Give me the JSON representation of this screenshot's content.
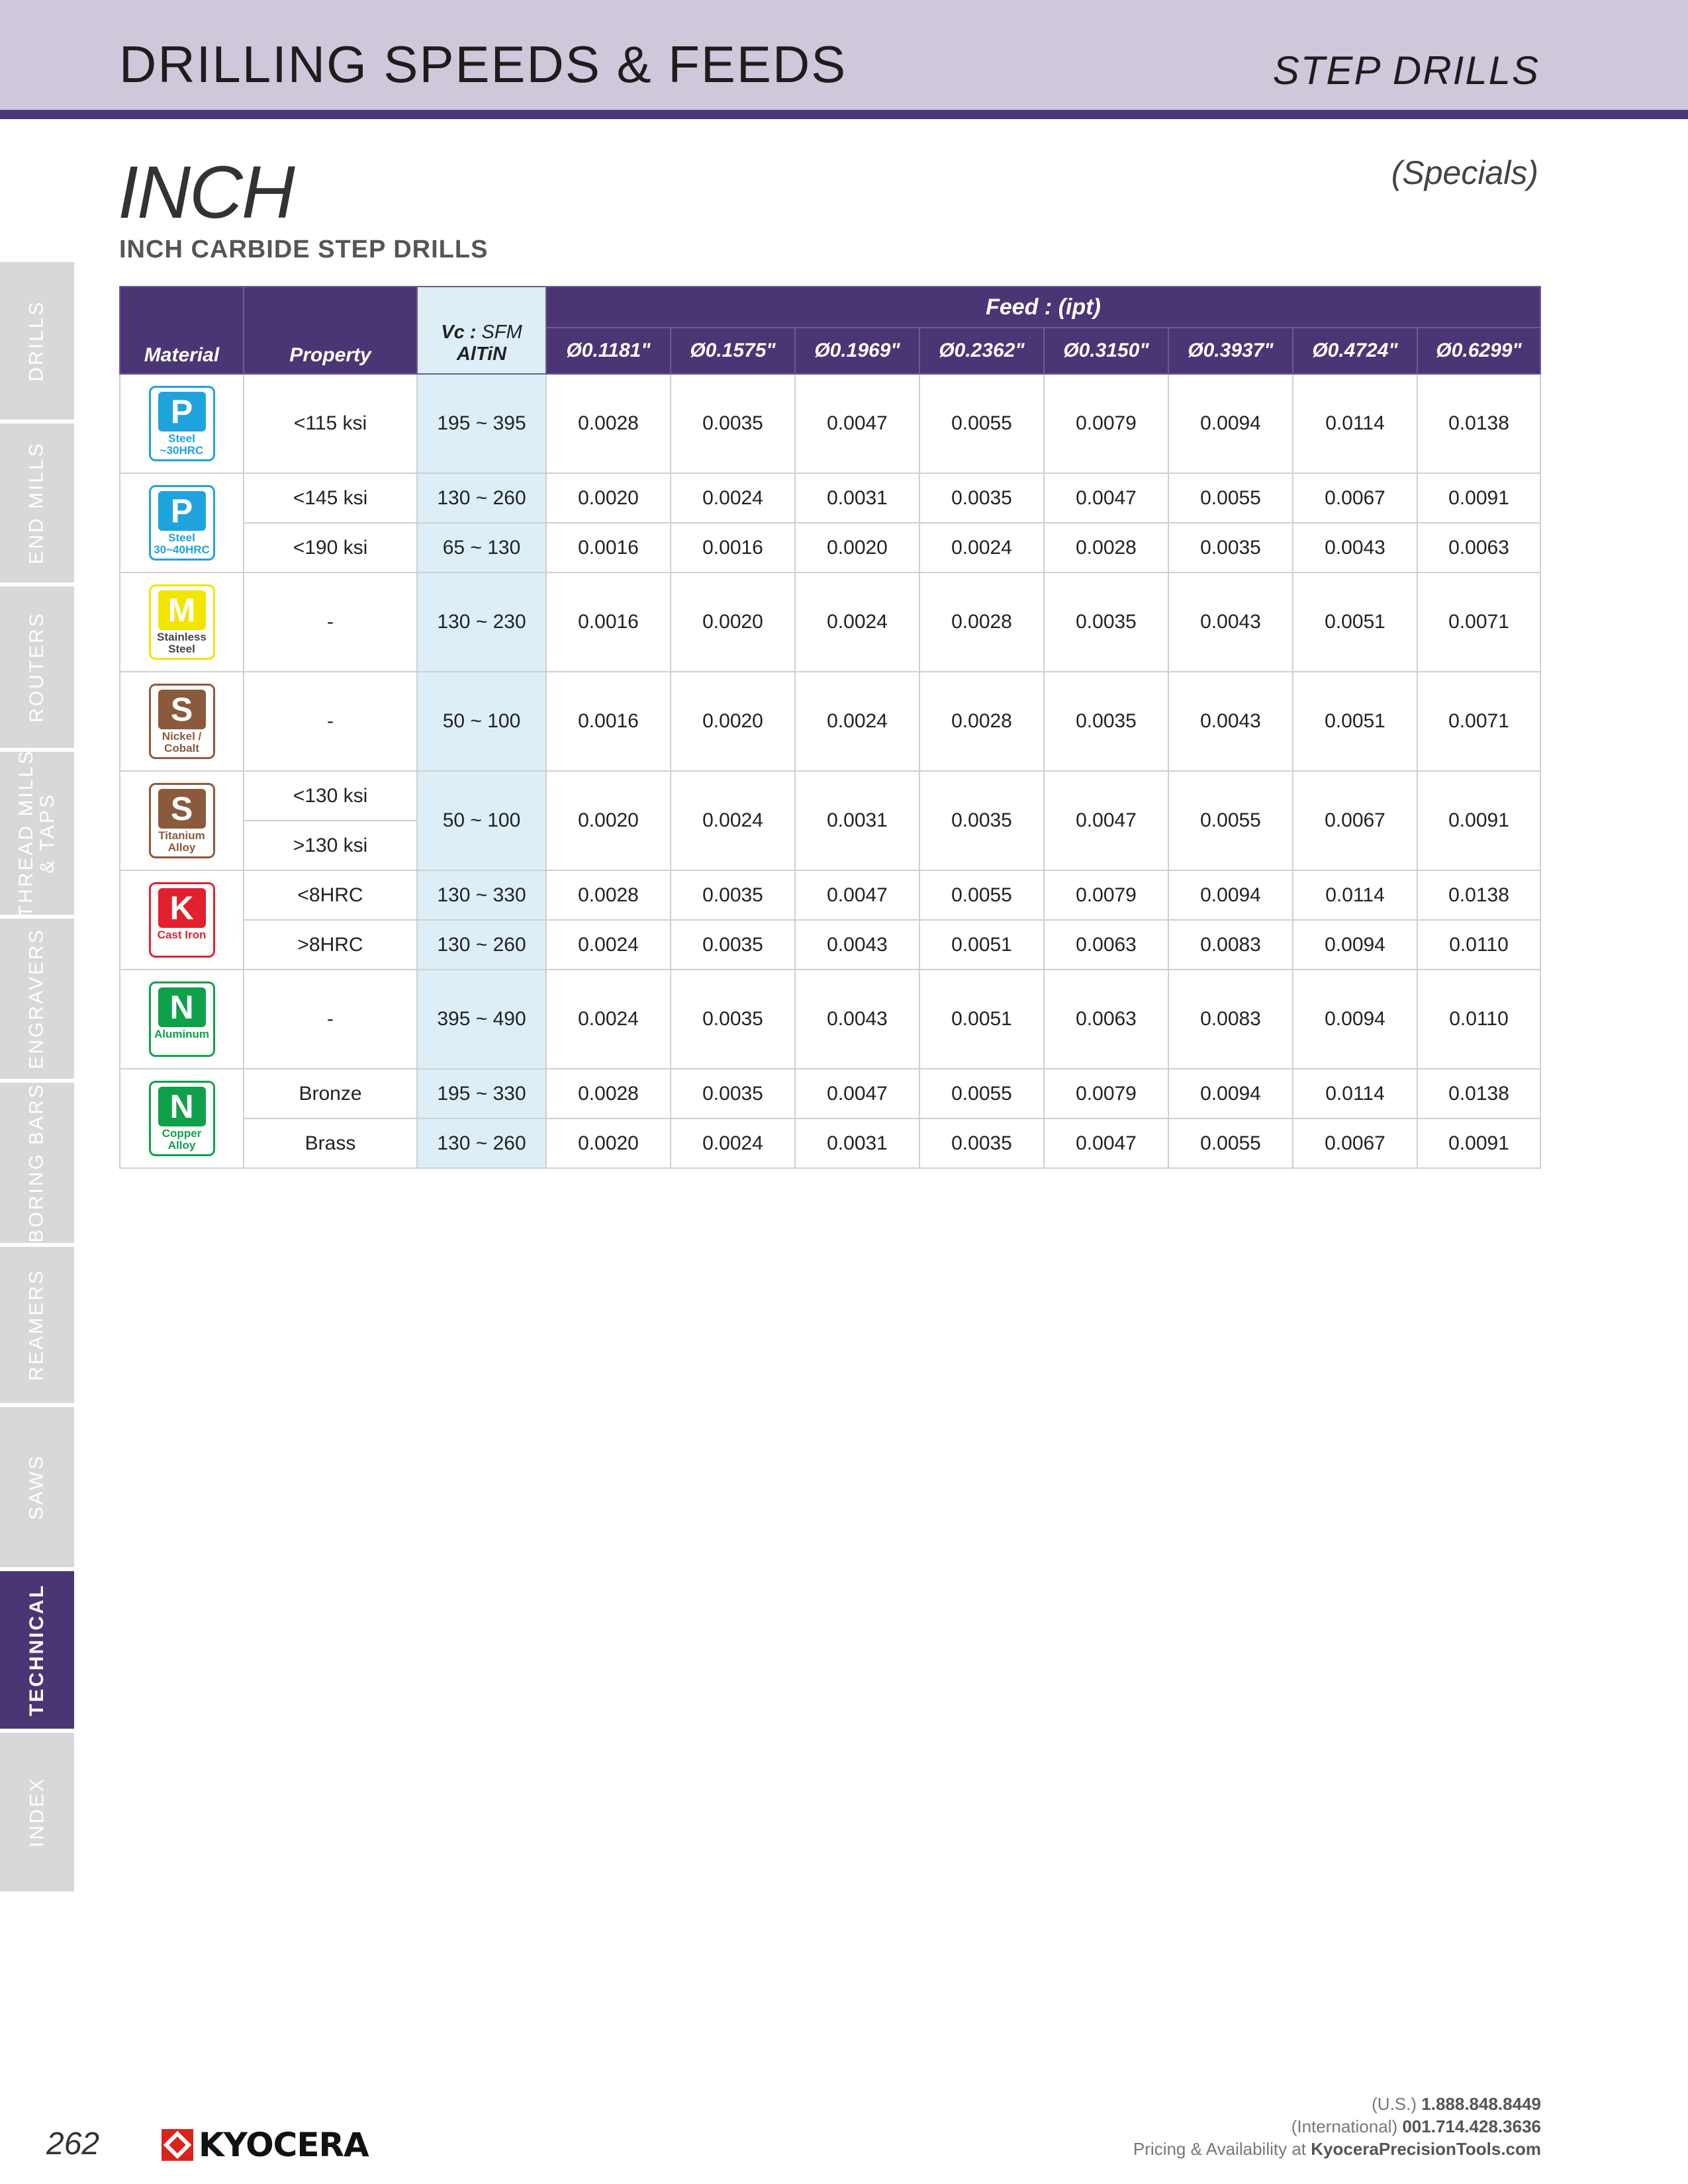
{
  "header": {
    "title": "DRILLING SPEEDS & FEEDS",
    "section": "STEP DRILLS"
  },
  "unit_title": "INCH",
  "specials": "(Specials)",
  "subtitle": "INCH CARBIDE STEP DRILLS",
  "side_tabs": [
    {
      "label": "DRILLS",
      "active": false
    },
    {
      "label": "END MILLS",
      "active": false
    },
    {
      "label": "ROUTERS",
      "active": false
    },
    {
      "label": "THREAD MILLS & TAPS",
      "line1": "THREAD MILLS",
      "line2": "& TAPS",
      "active": false
    },
    {
      "label": "ENGRAVERS",
      "active": false
    },
    {
      "label": "BORING BARS",
      "active": false
    },
    {
      "label": "REAMERS",
      "active": false
    },
    {
      "label": "SAWS",
      "active": false
    },
    {
      "label": "TECHNICAL",
      "active": true
    },
    {
      "label": "INDEX",
      "active": false
    }
  ],
  "table": {
    "material_header": "Material",
    "property_header": "Property",
    "vc_header_bold": "Vc :",
    "vc_header_unit": "SFM",
    "vc_header_coating": "AlTiN",
    "feed_header": "Feed : (ipt)",
    "diameters": [
      "Ø0.1181\"",
      "Ø0.1575\"",
      "Ø0.1969\"",
      "Ø0.2362\"",
      "Ø0.3150\"",
      "Ø0.3937\"",
      "Ø0.4724\"",
      "Ø0.6299\""
    ],
    "groups": [
      {
        "badge_letter": "P",
        "badge_name": "Steel ~30HRC",
        "badge_color": "#1fa3dc",
        "badge_text_color": "#1fa3dc",
        "rows": [
          {
            "property": "<115 ksi",
            "vc": "195 ~ 395",
            "feeds": [
              "0.0028",
              "0.0035",
              "0.0047",
              "0.0055",
              "0.0079",
              "0.0094",
              "0.0114",
              "0.0138"
            ]
          }
        ]
      },
      {
        "badge_letter": "P",
        "badge_name": "Steel 30~40HRC",
        "badge_color": "#1fa3dc",
        "badge_text_color": "#1fa3dc",
        "rows": [
          {
            "property": "<145 ksi",
            "vc": "130 ~ 260",
            "feeds": [
              "0.0020",
              "0.0024",
              "0.0031",
              "0.0035",
              "0.0047",
              "0.0055",
              "0.0067",
              "0.0091"
            ]
          },
          {
            "property": "<190 ksi",
            "vc": "65 ~ 130",
            "feeds": [
              "0.0016",
              "0.0016",
              "0.0020",
              "0.0024",
              "0.0028",
              "0.0035",
              "0.0043",
              "0.0063"
            ]
          }
        ]
      },
      {
        "badge_letter": "M",
        "badge_name": "Stainless Steel",
        "badge_color": "#f2e500",
        "badge_text_color": "#444444",
        "rows": [
          {
            "property": "-",
            "vc": "130 ~ 230",
            "feeds": [
              "0.0016",
              "0.0020",
              "0.0024",
              "0.0028",
              "0.0035",
              "0.0043",
              "0.0051",
              "0.0071"
            ]
          }
        ]
      },
      {
        "badge_letter": "S",
        "badge_name": "Nickel / Cobalt",
        "badge_color": "#8b5a3c",
        "badge_text_color": "#8b5a3c",
        "rows": [
          {
            "property": "-",
            "vc": "50 ~ 100",
            "feeds": [
              "0.0016",
              "0.0020",
              "0.0024",
              "0.0028",
              "0.0035",
              "0.0043",
              "0.0051",
              "0.0071"
            ]
          }
        ]
      },
      {
        "badge_letter": "S",
        "badge_name": "Titanium Alloy",
        "badge_color": "#8b5a3c",
        "badge_text_color": "#8b5a3c",
        "properties": [
          "<130 ksi",
          ">130 ksi"
        ],
        "vc": "50 ~ 100",
        "feeds": [
          "0.0020",
          "0.0024",
          "0.0031",
          "0.0035",
          "0.0047",
          "0.0055",
          "0.0067",
          "0.0091"
        ]
      },
      {
        "badge_letter": "K",
        "badge_name": "Cast Iron",
        "badge_color": "#e3202d",
        "badge_text_color": "#e3202d",
        "rows": [
          {
            "property": "<8HRC",
            "vc": "130 ~ 330",
            "feeds": [
              "0.0028",
              "0.0035",
              "0.0047",
              "0.0055",
              "0.0079",
              "0.0094",
              "0.0114",
              "0.0138"
            ]
          },
          {
            "property": ">8HRC",
            "vc": "130 ~ 260",
            "feeds": [
              "0.0024",
              "0.0035",
              "0.0043",
              "0.0051",
              "0.0063",
              "0.0083",
              "0.0094",
              "0.0110"
            ]
          }
        ]
      },
      {
        "badge_letter": "N",
        "badge_name": "Aluminum",
        "badge_color": "#0fa04a",
        "badge_text_color": "#0fa04a",
        "rows": [
          {
            "property": "-",
            "vc": "395 ~ 490",
            "feeds": [
              "0.0024",
              "0.0035",
              "0.0043",
              "0.0051",
              "0.0063",
              "0.0083",
              "0.0094",
              "0.0110"
            ]
          }
        ]
      },
      {
        "badge_letter": "N",
        "badge_name": "Copper Alloy",
        "badge_color": "#0fa04a",
        "badge_text_color": "#0fa04a",
        "rows": [
          {
            "property": "Bronze",
            "vc": "195 ~ 330",
            "feeds": [
              "0.0028",
              "0.0035",
              "0.0047",
              "0.0055",
              "0.0079",
              "0.0094",
              "0.0114",
              "0.0138"
            ]
          },
          {
            "property": "Brass",
            "vc": "130 ~ 260",
            "feeds": [
              "0.0020",
              "0.0024",
              "0.0031",
              "0.0035",
              "0.0047",
              "0.0055",
              "0.0067",
              "0.0091"
            ]
          }
        ]
      }
    ]
  },
  "footer": {
    "page_number": "262",
    "brand": "KYOCERA",
    "us_label": "(U.S.)",
    "us_phone": "1.888.848.8449",
    "intl_label": "(International)",
    "intl_phone": "001.714.428.3636",
    "availability_label": "Pricing & Availability at",
    "website": "KyoceraPrecisionTools.com"
  },
  "colors": {
    "header_band": "#d0c7db",
    "brand_purple": "#4a3674",
    "vc_column": "#ddeef6",
    "logo_red": "#d9241c"
  }
}
